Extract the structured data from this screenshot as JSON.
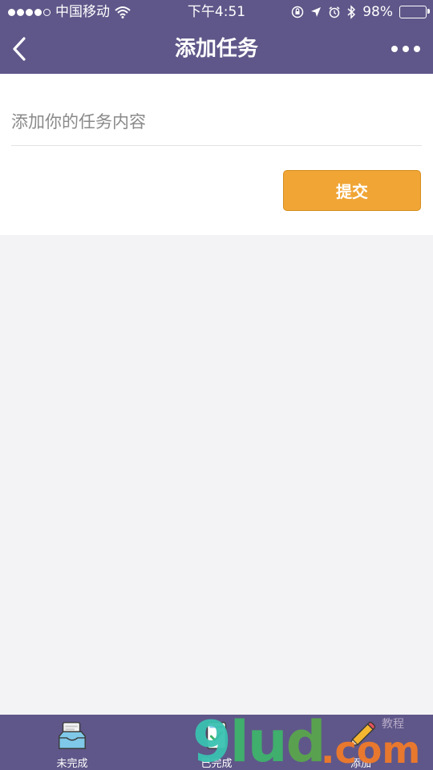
{
  "status_bar": {
    "carrier": "中国移动",
    "time": "下午4:51",
    "battery_percent": "98%",
    "battery_level": 0.98,
    "signal_bars_filled": 4,
    "signal_bars_total": 5
  },
  "header": {
    "title": "添加任务",
    "back_icon": "chevron-left-icon",
    "more_icon": "more-dots-icon",
    "background_color": "#5f5789"
  },
  "form": {
    "task_placeholder": "添加你的任务内容",
    "task_value": "",
    "submit_label": "提交",
    "submit_color": "#f0a535"
  },
  "tabbar": {
    "tabs": [
      {
        "label": "未完成",
        "icon": "inbox-tray-icon"
      },
      {
        "label": "已完成",
        "icon": "check-card-icon"
      },
      {
        "label": "添加",
        "icon": "pencil-icon"
      }
    ]
  },
  "watermark": {
    "letters": [
      "9",
      "lu",
      "d"
    ],
    "domain": ".com",
    "small_text": "教程"
  }
}
